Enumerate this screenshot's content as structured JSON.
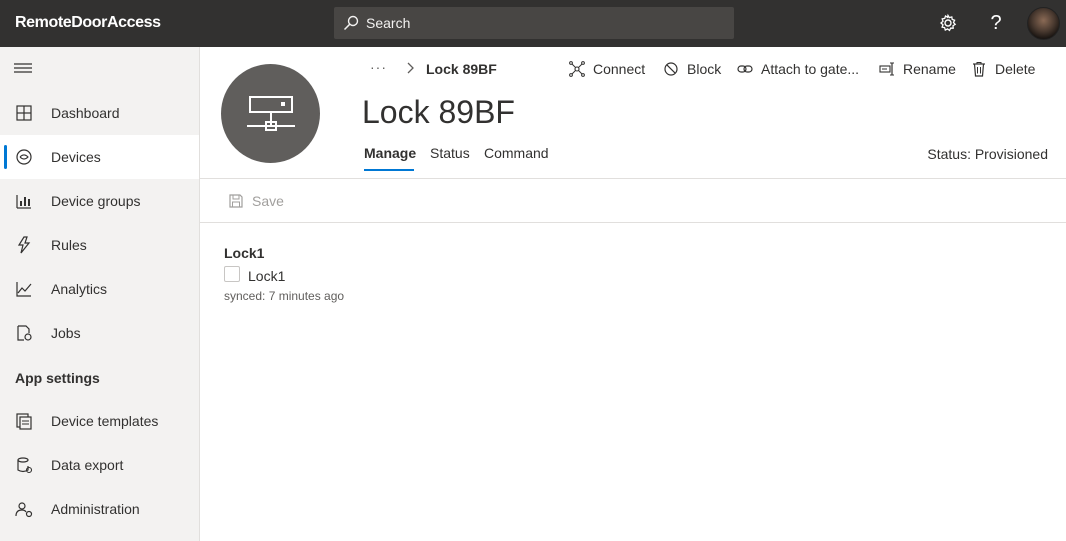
{
  "app": {
    "title": "RemoteDoorAccess"
  },
  "search": {
    "label": "Search",
    "icon": "search-icon"
  },
  "topbar": {
    "settings_icon": "gear-icon",
    "help_icon": "help-icon"
  },
  "sidebar": {
    "items": [
      {
        "label": "Dashboard",
        "icon": "dashboard-icon"
      },
      {
        "label": "Devices",
        "icon": "devices-icon",
        "active": true
      },
      {
        "label": "Device groups",
        "icon": "device-groups-icon"
      },
      {
        "label": "Rules",
        "icon": "rules-icon"
      },
      {
        "label": "Analytics",
        "icon": "analytics-icon"
      },
      {
        "label": "Jobs",
        "icon": "jobs-icon"
      }
    ],
    "section_label": "App settings",
    "settings_items": [
      {
        "label": "Device templates",
        "icon": "device-templates-icon"
      },
      {
        "label": "Data export",
        "icon": "data-export-icon"
      },
      {
        "label": "Administration",
        "icon": "administration-icon"
      }
    ]
  },
  "breadcrumb": {
    "more": "···",
    "current": "Lock 89BF"
  },
  "commands": [
    {
      "label": "Connect",
      "icon": "connect-icon"
    },
    {
      "label": "Block",
      "icon": "block-icon"
    },
    {
      "label": "Attach to gate...",
      "icon": "attach-icon"
    },
    {
      "label": "Rename",
      "icon": "rename-icon"
    },
    {
      "label": "Delete",
      "icon": "delete-icon"
    }
  ],
  "device": {
    "name": "Lock 89BF",
    "status": "Status: Provisioned"
  },
  "tabs": [
    {
      "label": "Manage",
      "active": true
    },
    {
      "label": "Status"
    },
    {
      "label": "Command"
    }
  ],
  "toolbar": {
    "save_label": "Save"
  },
  "properties": [
    {
      "label": "Lock1",
      "checkbox_label": "Lock1",
      "checked": false,
      "synced": "synced: 7 minutes ago"
    }
  ],
  "colors": {
    "topbar": "#323130",
    "accent": "#0078d4",
    "sidebar": "#f3f2f1",
    "device_avatar": "#605e5c"
  }
}
